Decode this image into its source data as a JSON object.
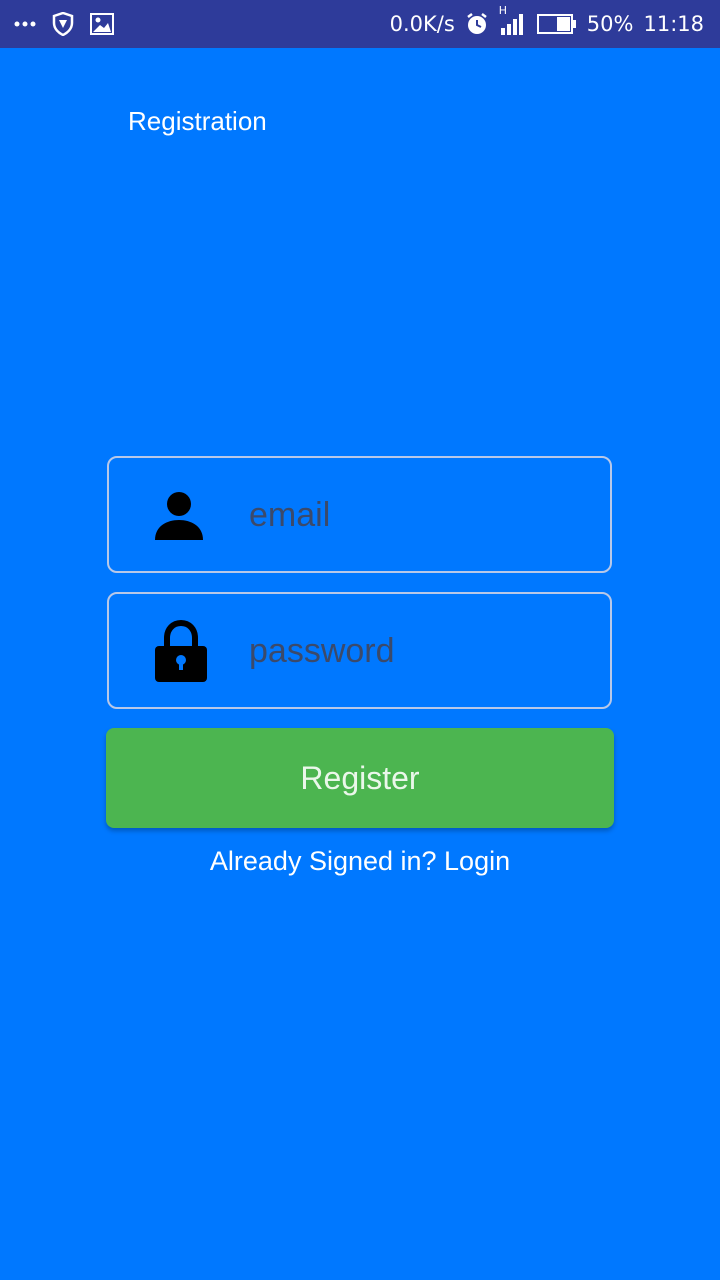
{
  "status_bar": {
    "speed": "0.0K/s",
    "network": "H",
    "battery": "50%",
    "time": "11:18",
    "icons": [
      "more-icon",
      "vpn-shield-icon",
      "image-icon",
      "alarm-icon",
      "signal-icon",
      "battery-icon"
    ]
  },
  "screen": {
    "title": "Registration",
    "background": "#0078FF"
  },
  "form": {
    "email_placeholder": "email",
    "password_placeholder": "password",
    "email_value": "",
    "password_value": "",
    "register_label": "Register",
    "login_link": "Already Signed in? Login",
    "register_color": "#4CB550"
  }
}
